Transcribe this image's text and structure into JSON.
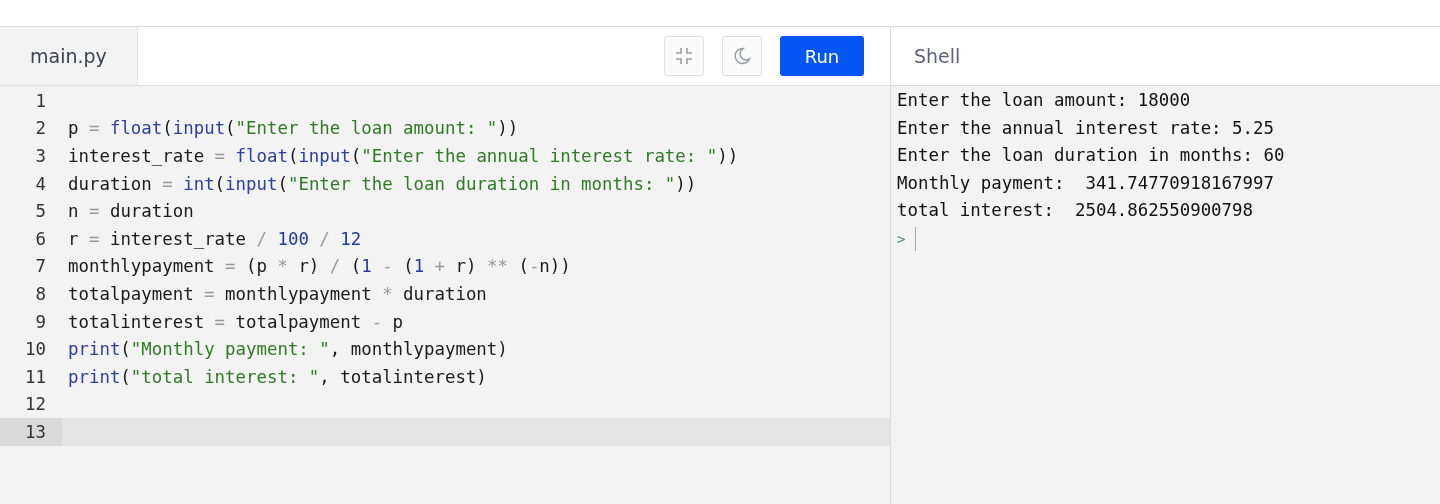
{
  "editor": {
    "file_tab": {
      "label": "main.py",
      "selected": true
    },
    "run_label": "Run",
    "lines": [
      {
        "number": "1",
        "active": false
      },
      {
        "number": "2",
        "active": false,
        "tokens": [
          {
            "text": "p",
            "kind": "plain"
          },
          {
            "text": " = ",
            "kind": "op"
          },
          {
            "text": "float",
            "kind": "builtin"
          },
          {
            "text": "(",
            "kind": "plain"
          },
          {
            "text": "input",
            "kind": "builtin"
          },
          {
            "text": "(",
            "kind": "plain"
          },
          {
            "text": "\"Enter the loan amount: \"",
            "kind": "string"
          },
          {
            "text": "))",
            "kind": "plain"
          }
        ]
      },
      {
        "number": "3",
        "active": false,
        "tokens": [
          {
            "text": "interest_rate",
            "kind": "plain"
          },
          {
            "text": " = ",
            "kind": "op"
          },
          {
            "text": "float",
            "kind": "builtin"
          },
          {
            "text": "(",
            "kind": "plain"
          },
          {
            "text": "input",
            "kind": "builtin"
          },
          {
            "text": "(",
            "kind": "plain"
          },
          {
            "text": "\"Enter the annual interest rate: \"",
            "kind": "string"
          },
          {
            "text": "))",
            "kind": "plain"
          }
        ]
      },
      {
        "number": "4",
        "active": false,
        "tokens": [
          {
            "text": "duration",
            "kind": "plain"
          },
          {
            "text": " = ",
            "kind": "op"
          },
          {
            "text": "int",
            "kind": "builtin"
          },
          {
            "text": "(",
            "kind": "plain"
          },
          {
            "text": "input",
            "kind": "builtin"
          },
          {
            "text": "(",
            "kind": "plain"
          },
          {
            "text": "\"Enter the loan duration in months: \"",
            "kind": "string"
          },
          {
            "text": "))",
            "kind": "plain"
          }
        ]
      },
      {
        "number": "5",
        "active": false,
        "tokens": [
          {
            "text": "n",
            "kind": "plain"
          },
          {
            "text": " = ",
            "kind": "op"
          },
          {
            "text": "duration",
            "kind": "plain"
          }
        ]
      },
      {
        "number": "6",
        "active": false,
        "tokens": [
          {
            "text": "r",
            "kind": "plain"
          },
          {
            "text": " = ",
            "kind": "op"
          },
          {
            "text": "interest_rate",
            "kind": "plain"
          },
          {
            "text": " / ",
            "kind": "op"
          },
          {
            "text": "100",
            "kind": "number"
          },
          {
            "text": " / ",
            "kind": "op"
          },
          {
            "text": "12",
            "kind": "number"
          }
        ]
      },
      {
        "number": "7",
        "active": false,
        "tokens": [
          {
            "text": "monthlypayment",
            "kind": "plain"
          },
          {
            "text": " = ",
            "kind": "op"
          },
          {
            "text": "(p",
            "kind": "plain"
          },
          {
            "text": " * ",
            "kind": "op"
          },
          {
            "text": "r)",
            "kind": "plain"
          },
          {
            "text": " / ",
            "kind": "op"
          },
          {
            "text": "(",
            "kind": "plain"
          },
          {
            "text": "1",
            "kind": "number"
          },
          {
            "text": " - ",
            "kind": "op"
          },
          {
            "text": "(",
            "kind": "plain"
          },
          {
            "text": "1",
            "kind": "number"
          },
          {
            "text": " + ",
            "kind": "op"
          },
          {
            "text": "r)",
            "kind": "plain"
          },
          {
            "text": " ** ",
            "kind": "op"
          },
          {
            "text": "(",
            "kind": "plain"
          },
          {
            "text": "-",
            "kind": "op"
          },
          {
            "text": "n))",
            "kind": "plain"
          }
        ]
      },
      {
        "number": "8",
        "active": false,
        "tokens": [
          {
            "text": "totalpayment",
            "kind": "plain"
          },
          {
            "text": " = ",
            "kind": "op"
          },
          {
            "text": "monthlypayment",
            "kind": "plain"
          },
          {
            "text": " * ",
            "kind": "op"
          },
          {
            "text": "duration",
            "kind": "plain"
          }
        ]
      },
      {
        "number": "9",
        "active": false,
        "tokens": [
          {
            "text": "totalinterest",
            "kind": "plain"
          },
          {
            "text": " = ",
            "kind": "op"
          },
          {
            "text": "totalpayment",
            "kind": "plain"
          },
          {
            "text": " - ",
            "kind": "op"
          },
          {
            "text": "p",
            "kind": "plain"
          }
        ]
      },
      {
        "number": "10",
        "active": false,
        "tokens": [
          {
            "text": "print",
            "kind": "builtin"
          },
          {
            "text": "(",
            "kind": "plain"
          },
          {
            "text": "\"Monthly payment: \"",
            "kind": "string"
          },
          {
            "text": ", monthlypayment)",
            "kind": "plain"
          }
        ]
      },
      {
        "number": "11",
        "active": false,
        "tokens": [
          {
            "text": "print",
            "kind": "builtin"
          },
          {
            "text": "(",
            "kind": "plain"
          },
          {
            "text": "\"total interest: \"",
            "kind": "string"
          },
          {
            "text": ", totalinterest)",
            "kind": "plain"
          }
        ]
      },
      {
        "number": "12",
        "active": false
      },
      {
        "number": "13",
        "active": true
      }
    ]
  },
  "shell": {
    "title": "Shell",
    "output": [
      "Enter the loan amount: 18000",
      "Enter the annual interest rate: 5.25",
      "Enter the loan duration in months: 60",
      "Monthly payment:  341.74770918167997",
      "total interest:  2504.862550900798"
    ],
    "prompt": ">"
  }
}
